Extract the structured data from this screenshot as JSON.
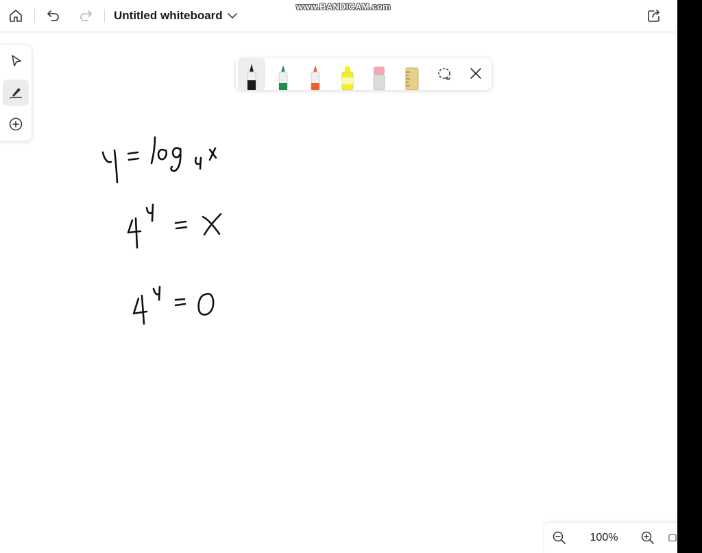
{
  "header": {
    "title": "Untitled whiteboard",
    "icons": [
      "home-icon",
      "undo-icon",
      "redo-icon",
      "chevron-down-icon",
      "share-icon"
    ]
  },
  "watermark": {
    "text": "www.BANDICAM.com"
  },
  "side_tools": [
    "select-icon",
    "pen-icon",
    "add-icon"
  ],
  "pen_tray": {
    "pens": [
      {
        "name": "black-pen",
        "color": "#1a1a1a",
        "selected": true
      },
      {
        "name": "green-pen",
        "color": "#1f8f4e"
      },
      {
        "name": "orange-pen",
        "color": "#e8622a"
      },
      {
        "name": "yellow-highlighter",
        "color": "#f5ef2a"
      },
      {
        "name": "eraser",
        "color": "#f3a6b4"
      },
      {
        "name": "ruler",
        "color": "#e8cf8a"
      }
    ],
    "icons": [
      "lasso-icon",
      "close-icon"
    ]
  },
  "canvas": {
    "lines": [
      "y = log₄ x",
      "4ʸ = x",
      "4ʸ = 0"
    ]
  },
  "zoom": {
    "value": "100%"
  },
  "colors": {
    "ink": "#111111",
    "accent_bg": "#ececec"
  }
}
